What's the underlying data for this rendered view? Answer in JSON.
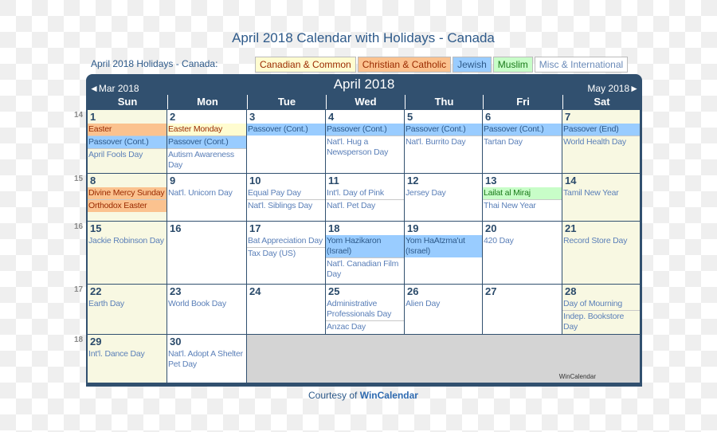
{
  "page_title": "April 2018 Calendar with Holidays - Canada",
  "subtitle": "April 2018 Holidays - Canada:",
  "legend": [
    {
      "label": "Canadian & Common",
      "type": "can"
    },
    {
      "label": "Christian & Catholic",
      "type": "chr"
    },
    {
      "label": "Jewish",
      "type": "jew"
    },
    {
      "label": "Muslim",
      "type": "mus"
    },
    {
      "label": "Misc & International",
      "type": "misc"
    }
  ],
  "calendar": {
    "month_title": "April 2018",
    "prev_label": "◄Mar 2018",
    "next_label": "May 2018►",
    "days_of_week": [
      "Sun",
      "Mon",
      "Tue",
      "Wed",
      "Thu",
      "Fri",
      "Sat"
    ],
    "weeks": [
      {
        "week_number": "14",
        "days": [
          {
            "day": "1",
            "events": [
              {
                "name": "Easter",
                "type": "chr"
              },
              {
                "name": "Passover (Cont.)",
                "type": "jew"
              },
              {
                "name": "April Fools Day",
                "type": "misc"
              }
            ]
          },
          {
            "day": "2",
            "events": [
              {
                "name": "Easter Monday",
                "type": "can"
              },
              {
                "name": "Passover (Cont.)",
                "type": "jew"
              },
              {
                "name": "Autism Awareness Day",
                "type": "misc"
              }
            ]
          },
          {
            "day": "3",
            "events": [
              {
                "name": "Passover (Cont.)",
                "type": "jew"
              }
            ]
          },
          {
            "day": "4",
            "events": [
              {
                "name": "Passover (Cont.)",
                "type": "jew"
              },
              {
                "name": "Nat'l. Hug a Newsperson Day",
                "type": "misc"
              }
            ]
          },
          {
            "day": "5",
            "events": [
              {
                "name": "Passover (Cont.)",
                "type": "jew"
              },
              {
                "name": "Nat'l. Burrito Day",
                "type": "misc"
              }
            ]
          },
          {
            "day": "6",
            "events": [
              {
                "name": "Passover (Cont.)",
                "type": "jew"
              },
              {
                "name": "Tartan Day",
                "type": "misc"
              }
            ]
          },
          {
            "day": "7",
            "events": [
              {
                "name": "Passover (End)",
                "type": "jew"
              },
              {
                "name": "World Health Day",
                "type": "misc"
              }
            ]
          }
        ]
      },
      {
        "week_number": "15",
        "days": [
          {
            "day": "8",
            "events": [
              {
                "name": "Divine Mercy Sunday",
                "type": "chr"
              },
              {
                "name": "Orthodox Easter",
                "type": "chr"
              }
            ]
          },
          {
            "day": "9",
            "events": [
              {
                "name": "Nat'l. Unicorn Day",
                "type": "misc"
              }
            ]
          },
          {
            "day": "10",
            "events": [
              {
                "name": "Equal Pay Day",
                "type": "misc"
              },
              {
                "name": "Nat'l. Siblings Day",
                "type": "misc"
              }
            ]
          },
          {
            "day": "11",
            "events": [
              {
                "name": "Int'l. Day of Pink",
                "type": "misc"
              },
              {
                "name": "Nat'l. Pet Day",
                "type": "misc"
              }
            ]
          },
          {
            "day": "12",
            "events": [
              {
                "name": "Jersey Day",
                "type": "misc"
              }
            ]
          },
          {
            "day": "13",
            "events": [
              {
                "name": "Lailat al Miraj",
                "type": "mus"
              },
              {
                "name": "Thai New Year",
                "type": "misc"
              }
            ]
          },
          {
            "day": "14",
            "events": [
              {
                "name": "Tamil New Year",
                "type": "misc"
              }
            ]
          }
        ]
      },
      {
        "week_number": "16",
        "days": [
          {
            "day": "15",
            "events": [
              {
                "name": "Jackie Robinson Day",
                "type": "misc"
              }
            ]
          },
          {
            "day": "16",
            "events": []
          },
          {
            "day": "17",
            "events": [
              {
                "name": "Bat Appreciation Day",
                "type": "misc"
              },
              {
                "name": "Tax Day (US)",
                "type": "misc"
              }
            ]
          },
          {
            "day": "18",
            "events": [
              {
                "name": "Yom Hazikaron (Israel)",
                "type": "jew"
              },
              {
                "name": "Nat'l. Canadian Film Day",
                "type": "misc"
              }
            ]
          },
          {
            "day": "19",
            "events": [
              {
                "name": "Yom HaAtzma'ut (Israel)",
                "type": "jew"
              }
            ]
          },
          {
            "day": "20",
            "events": [
              {
                "name": "420 Day",
                "type": "misc"
              }
            ]
          },
          {
            "day": "21",
            "events": [
              {
                "name": "Record Store Day",
                "type": "misc"
              }
            ]
          }
        ]
      },
      {
        "week_number": "17",
        "days": [
          {
            "day": "22",
            "events": [
              {
                "name": "Earth Day",
                "type": "misc"
              }
            ]
          },
          {
            "day": "23",
            "events": [
              {
                "name": "World Book Day",
                "type": "misc"
              }
            ]
          },
          {
            "day": "24",
            "events": []
          },
          {
            "day": "25",
            "events": [
              {
                "name": "Administrative Professionals Day",
                "type": "misc"
              },
              {
                "name": "Anzac Day",
                "type": "misc"
              }
            ]
          },
          {
            "day": "26",
            "events": [
              {
                "name": "Alien Day",
                "type": "misc"
              }
            ]
          },
          {
            "day": "27",
            "events": []
          },
          {
            "day": "28",
            "events": [
              {
                "name": "Day of Mourning",
                "type": "misc"
              },
              {
                "name": "Indep. Bookstore Day",
                "type": "misc"
              }
            ]
          }
        ]
      },
      {
        "week_number": "18",
        "days": [
          {
            "day": "29",
            "events": [
              {
                "name": "Int'l. Dance Day",
                "type": "misc"
              }
            ]
          },
          {
            "day": "30",
            "events": [
              {
                "name": "Nat'l. Adopt A Shelter Pet Day",
                "type": "misc"
              }
            ]
          }
        ]
      }
    ],
    "watermark": "WinCalendar"
  },
  "footer": {
    "prefix": "Courtesy of ",
    "link": "WinCalendar"
  }
}
